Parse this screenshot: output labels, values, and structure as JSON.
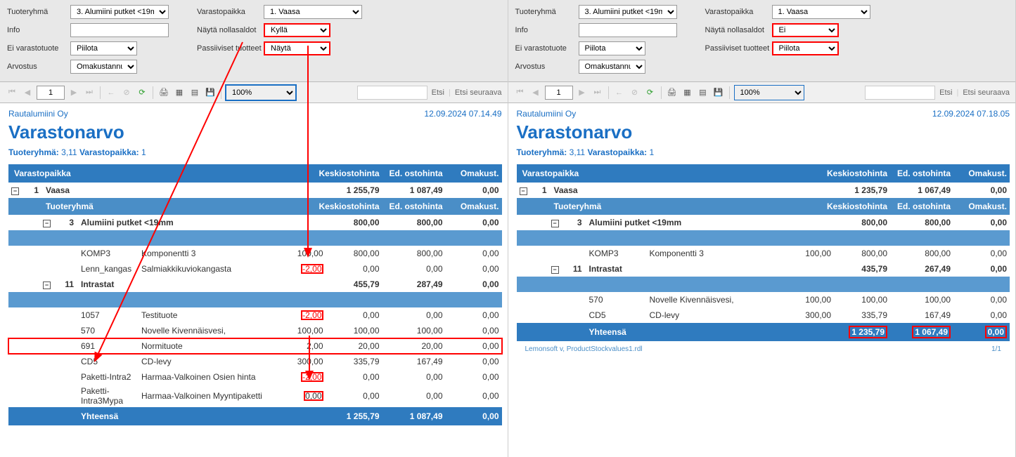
{
  "left": {
    "filters": {
      "tuoteryhma_label": "Tuoteryhmä",
      "tuoteryhma_value": "3. Alumiini putket <19mm",
      "info_label": "Info",
      "info_value": "",
      "ei_varastotuote_label": "Ei varastotuote",
      "ei_varastotuote_value": "Piilota",
      "arvostus_label": "Arvostus",
      "arvostus_value": "Omakustannus",
      "varastopaikka_label": "Varastopaikka",
      "varastopaikka_value": "1. Vaasa",
      "nayta_nollasaldot_label": "Näytä nollasaldot",
      "nayta_nollasaldot_value": "Kyllä",
      "passiiviset_label": "Passiiviset tuotteet",
      "passiiviset_value": "Näytä"
    },
    "toolbar": {
      "page": "1",
      "zoom": "100%",
      "etsi": "Etsi",
      "etsi_seuraava": "Etsi seuraava"
    },
    "report": {
      "company": "Rautalumiini Oy",
      "datetime": "12.09.2024 07.14.49",
      "title": "Varastonarvo",
      "subtitle_tuoteryhma_label": "Tuoteryhmä:",
      "subtitle_tuoteryhma_value": "3,11",
      "subtitle_varastopaikka_label": "Varastopaikka:",
      "subtitle_varastopaikka_value": "1",
      "col_varastopaikka": "Varastopaikka",
      "col_tuoteryhma": "Tuoteryhmä",
      "col_keskio": "Keskiostohinta",
      "col_ed": "Ed. ostohinta",
      "col_omak": "Omakust.",
      "loc_idx": "1",
      "loc_name": "Vaasa",
      "loc_keskio": "1 255,79",
      "loc_ed": "1 087,49",
      "loc_omak": "0,00",
      "grp1_idx": "3",
      "grp1_name": "Alumiini putket <19mm",
      "grp1_keskio": "800,00",
      "grp1_ed": "800,00",
      "grp1_omak": "0,00",
      "r1_code": "KOMP3",
      "r1_name": "Komponentti 3",
      "r1_qty": "100,00",
      "r1_keskio": "800,00",
      "r1_ed": "800,00",
      "r1_omak": "0,00",
      "r2_code": "Lenn_kangas",
      "r2_name": "Salmiakkikuviokangasta",
      "r2_qty": "-2,00",
      "r2_keskio": "0,00",
      "r2_ed": "0,00",
      "r2_omak": "0,00",
      "grp2_idx": "11",
      "grp2_name": "Intrastat",
      "grp2_keskio": "455,79",
      "grp2_ed": "287,49",
      "grp2_omak": "0,00",
      "r3_code": "1057",
      "r3_name": "Testituote",
      "r3_qty": "-2,00",
      "r3_keskio": "0,00",
      "r3_ed": "0,00",
      "r3_omak": "0,00",
      "r4_code": "570",
      "r4_name": "Novelle Kivennäisvesi,",
      "r4_qty": "100,00",
      "r4_keskio": "100,00",
      "r4_ed": "100,00",
      "r4_omak": "0,00",
      "r5_code": "691",
      "r5_name": "Normituote",
      "r5_qty": "2,00",
      "r5_keskio": "20,00",
      "r5_ed": "20,00",
      "r5_omak": "0,00",
      "r6_code": "CD5",
      "r6_name": "CD-levy",
      "r6_qty": "300,00",
      "r6_keskio": "335,79",
      "r6_ed": "167,49",
      "r6_omak": "0,00",
      "r7_code": "Paketti-Intra2",
      "r7_name": "Harmaa-Valkoinen Osien hinta",
      "r7_qty": "-2,00",
      "r7_keskio": "0,00",
      "r7_ed": "0,00",
      "r7_omak": "0,00",
      "r8_code": "Paketti-Intra3Mypa",
      "r8_name": "Harmaa-Valkoinen Myyntipaketti",
      "r8_qty": "0,00",
      "r8_keskio": "0,00",
      "r8_ed": "0,00",
      "r8_omak": "0,00",
      "total_label": "Yhteensä",
      "total_keskio": "1 255,79",
      "total_ed": "1 087,49",
      "total_omak": "0,00"
    }
  },
  "right": {
    "filters": {
      "tuoteryhma_label": "Tuoteryhmä",
      "tuoteryhma_value": "3. Alumiini putket <19mm",
      "info_label": "Info",
      "info_value": "",
      "ei_varastotuote_label": "Ei varastotuote",
      "ei_varastotuote_value": "Piilota",
      "arvostus_label": "Arvostus",
      "arvostus_value": "Omakustannus",
      "varastopaikka_label": "Varastopaikka",
      "varastopaikka_value": "1. Vaasa",
      "nayta_nollasaldot_label": "Näytä nollasaldot",
      "nayta_nollasaldot_value": "Ei",
      "passiiviset_label": "Passiiviset tuotteet",
      "passiiviset_value": "Piilota"
    },
    "toolbar": {
      "page": "1",
      "zoom": "100%",
      "etsi": "Etsi",
      "etsi_seuraava": "Etsi seuraava"
    },
    "report": {
      "company": "Rautalumiini Oy",
      "datetime": "12.09.2024 07.18.05",
      "title": "Varastonarvo",
      "subtitle_tuoteryhma_label": "Tuoteryhmä:",
      "subtitle_tuoteryhma_value": "3,11",
      "subtitle_varastopaikka_label": "Varastopaikka:",
      "subtitle_varastopaikka_value": "1",
      "col_varastopaikka": "Varastopaikka",
      "col_tuoteryhma": "Tuoteryhmä",
      "col_keskio": "Keskiostohinta",
      "col_ed": "Ed. ostohinta",
      "col_omak": "Omakust.",
      "loc_idx": "1",
      "loc_name": "Vaasa",
      "loc_keskio": "1 235,79",
      "loc_ed": "1 067,49",
      "loc_omak": "0,00",
      "grp1_idx": "3",
      "grp1_name": "Alumiini putket <19mm",
      "grp1_keskio": "800,00",
      "grp1_ed": "800,00",
      "grp1_omak": "0,00",
      "r1_code": "KOMP3",
      "r1_name": "Komponentti 3",
      "r1_qty": "100,00",
      "r1_keskio": "800,00",
      "r1_ed": "800,00",
      "r1_omak": "0,00",
      "grp2_idx": "11",
      "grp2_name": "Intrastat",
      "grp2_keskio": "435,79",
      "grp2_ed": "267,49",
      "grp2_omak": "0,00",
      "r4_code": "570",
      "r4_name": "Novelle Kivennäisvesi,",
      "r4_qty": "100,00",
      "r4_keskio": "100,00",
      "r4_ed": "100,00",
      "r4_omak": "0,00",
      "r6_code": "CD5",
      "r6_name": "CD-levy",
      "r6_qty": "300,00",
      "r6_keskio": "335,79",
      "r6_ed": "167,49",
      "r6_omak": "0,00",
      "total_label": "Yhteensä",
      "total_keskio": "1 235,79",
      "total_ed": "1 067,49",
      "total_omak": "0,00",
      "footer_left": "Lemonsoft v, ProductStockvalues1.rdl",
      "footer_right": "1/1"
    }
  }
}
